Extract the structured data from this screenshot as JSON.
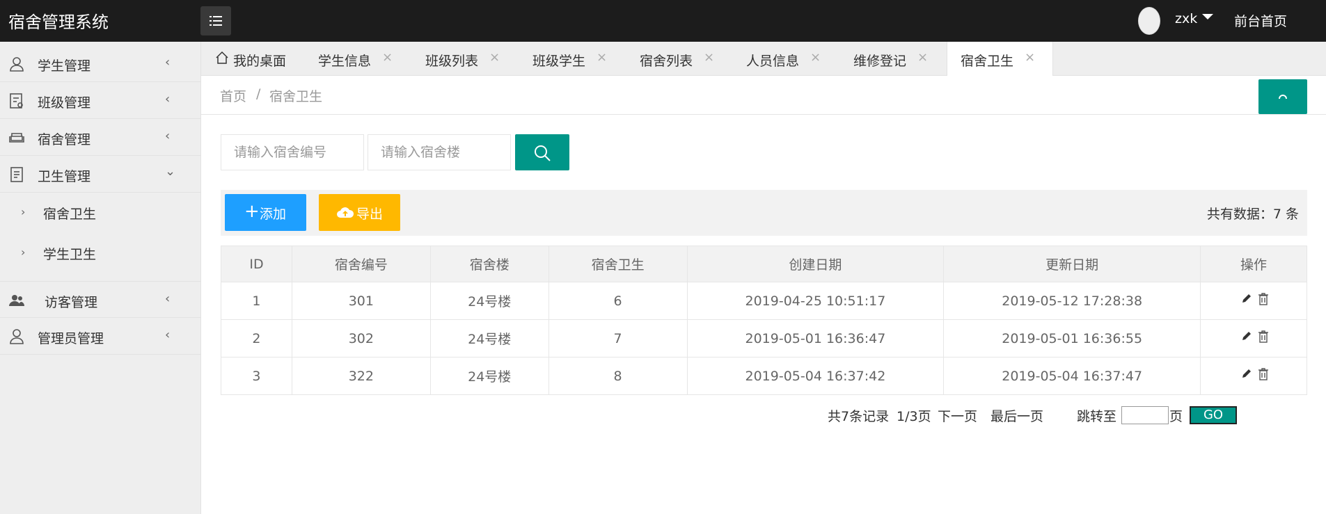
{
  "header": {
    "logo": "宿舍管理系统",
    "user_name": "zxk",
    "front_link": "前台首页"
  },
  "sidebar": {
    "items": [
      {
        "label": "学生管理",
        "icon": "user-icon"
      },
      {
        "label": "班级管理",
        "icon": "class-icon"
      },
      {
        "label": "宿舍管理",
        "icon": "sofa-icon"
      },
      {
        "label": "卫生管理",
        "icon": "document-icon"
      },
      {
        "label": "访客管理",
        "icon": "users-icon"
      },
      {
        "label": "管理员管理",
        "icon": "admin-icon"
      }
    ],
    "sub_items": [
      {
        "label": "宿舍卫生"
      },
      {
        "label": "学生卫生"
      }
    ]
  },
  "tabs": [
    {
      "label": "我的桌面"
    },
    {
      "label": "学生信息"
    },
    {
      "label": "班级列表"
    },
    {
      "label": "班级学生"
    },
    {
      "label": "宿舍列表"
    },
    {
      "label": "人员信息"
    },
    {
      "label": "维修登记"
    },
    {
      "label": "宿舍卫生"
    }
  ],
  "breadcrumb": {
    "home": "首页",
    "separator": "/",
    "current": "宿舍卫生"
  },
  "search": {
    "dorm_number_placeholder": "请输入宿舍编号",
    "building_placeholder": "请输入宿舍楼"
  },
  "toolbar": {
    "add_label": "添加",
    "export_label": "导出",
    "total_text": "共有数据：7 条"
  },
  "table": {
    "headers": [
      "ID",
      "宿舍编号",
      "宿舍楼",
      "宿舍卫生",
      "创建日期",
      "更新日期",
      "操作"
    ],
    "rows": [
      [
        "1",
        "301",
        "24号楼",
        "6",
        "2019-04-25 10:51:17",
        "2019-05-12 17:28:38"
      ],
      [
        "2",
        "302",
        "24号楼",
        "7",
        "2019-05-01 16:36:47",
        "2019-05-01 16:36:55"
      ],
      [
        "3",
        "322",
        "24号楼",
        "8",
        "2019-05-04 16:37:42",
        "2019-05-04 16:37:47"
      ]
    ]
  },
  "pagination": {
    "records": "共7条记录",
    "page_info": "1/3页",
    "next": "下一页",
    "last": "最后一页",
    "jump_label": "跳转至",
    "page_suffix": "页",
    "go": "GO"
  },
  "colors": {
    "primary": "#009688",
    "blue": "#1e9fff",
    "yellow": "#ffb800",
    "header_bg": "#1c1c1c"
  }
}
